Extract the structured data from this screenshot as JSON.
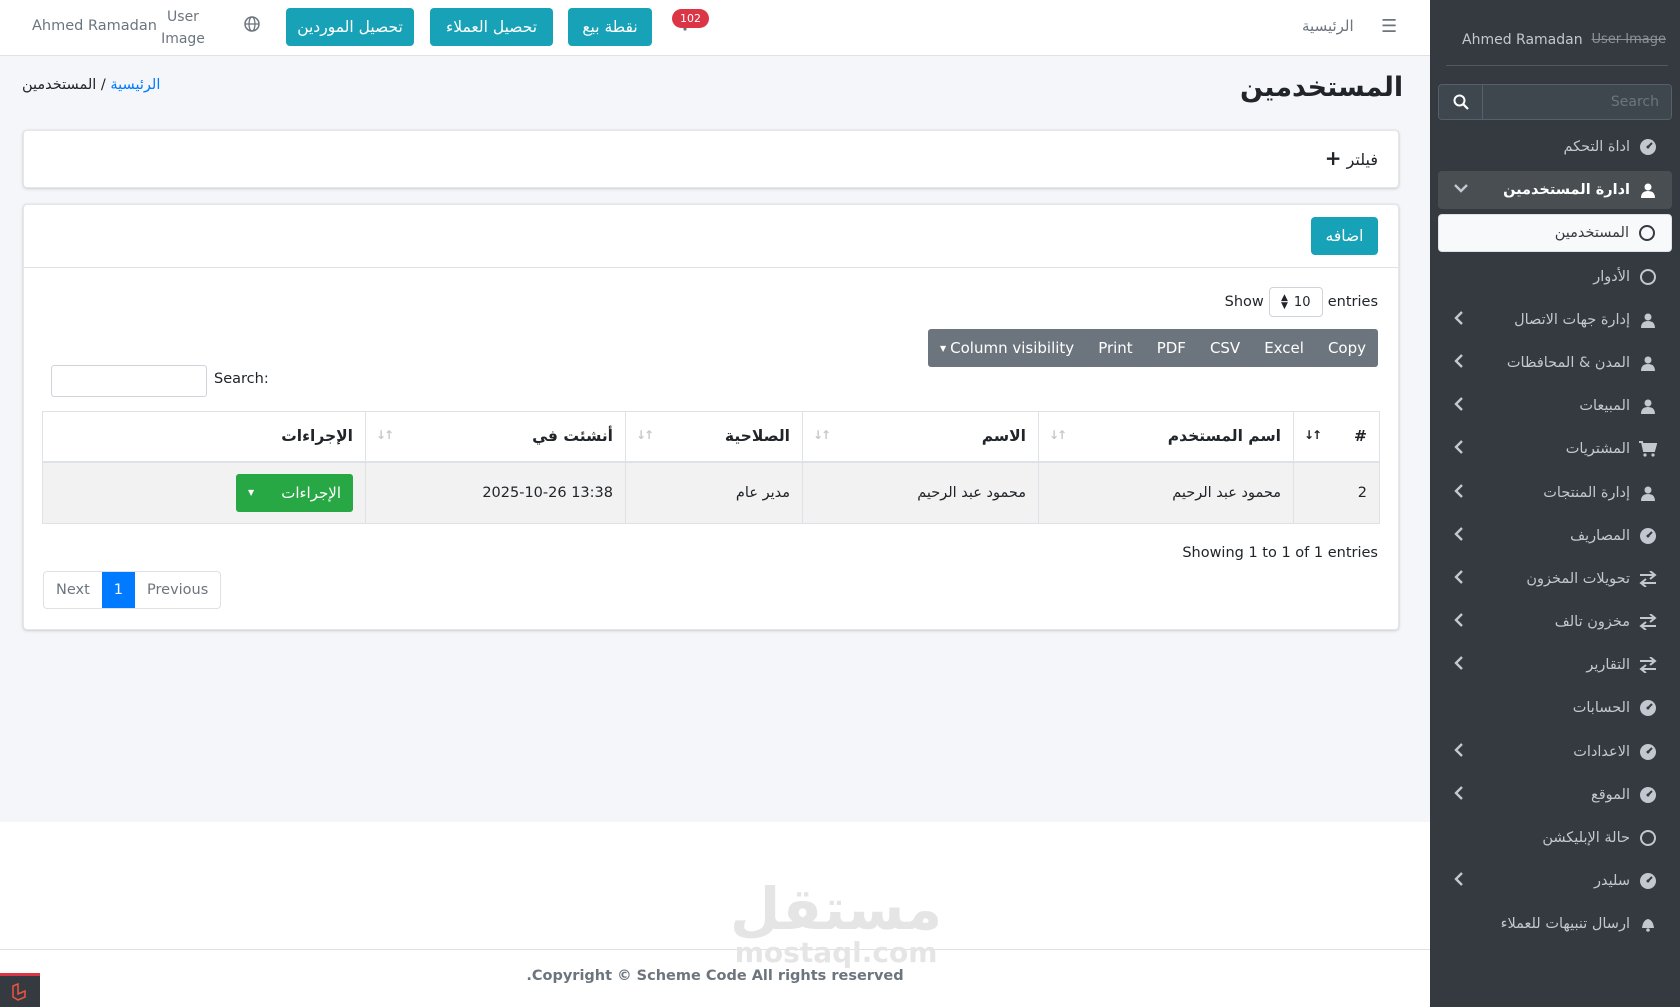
{
  "sidebar": {
    "user_name": "Ahmed Ramadan",
    "user_image_alt": "User Image",
    "search_placeholder": "Search",
    "items": [
      {
        "label": "اداة التحكم",
        "icon": "dashboard-icon",
        "chevron": false
      },
      {
        "label": "ادارة المستخدمين",
        "icon": "user-icon",
        "chevron": true,
        "state": "active"
      },
      {
        "label": "المستخدمين",
        "icon": "circle-icon",
        "chevron": false,
        "state": "current"
      },
      {
        "label": "الأدوار",
        "icon": "circle-icon",
        "chevron": false
      },
      {
        "label": "إدارة جهات الاتصال",
        "icon": "user-icon",
        "chevron": true
      },
      {
        "label": "المدن & المحافظات",
        "icon": "user-icon",
        "chevron": true
      },
      {
        "label": "المبيعات",
        "icon": "user-icon",
        "chevron": true
      },
      {
        "label": "المشتريات",
        "icon": "cart-icon",
        "chevron": true
      },
      {
        "label": "إدارة المنتجات",
        "icon": "user-icon",
        "chevron": true
      },
      {
        "label": "المصاريف",
        "icon": "dashboard-icon",
        "chevron": true
      },
      {
        "label": "تحويلات المخزون",
        "icon": "exchange-icon",
        "chevron": true
      },
      {
        "label": "مخزون تالف",
        "icon": "exchange-icon",
        "chevron": true
      },
      {
        "label": "التقارير",
        "icon": "exchange-icon",
        "chevron": true
      },
      {
        "label": "الحسابات",
        "icon": "dashboard-icon",
        "chevron": false
      },
      {
        "label": "الاعدادات",
        "icon": "dashboard-icon",
        "chevron": true
      },
      {
        "label": "الموقع",
        "icon": "dashboard-icon",
        "chevron": true
      },
      {
        "label": "حالة الإبليكشن",
        "icon": "circle-icon",
        "chevron": false
      },
      {
        "label": "سليدر",
        "icon": "dashboard-icon",
        "chevron": true
      },
      {
        "label": "ارسال تنبيهات للعملاء",
        "icon": "bell-icon",
        "chevron": false
      }
    ]
  },
  "topbar": {
    "home_label": "الرئيسية",
    "btn_pos": "نقطة بيع",
    "btn_customers": "تحصيل العملاء",
    "btn_suppliers": "تحصيل الموردين",
    "notification_count": "102",
    "user_image_alt": "User Image",
    "user_name": "Ahmed Ramadan"
  },
  "page": {
    "title": "المستخدمين",
    "breadcrumb_home": "الرئيسية",
    "breadcrumb_sep": " / ",
    "breadcrumb_current": "المستخدمين",
    "filter_label": "فيلتر",
    "add_button": "اضافه",
    "show_label": "Show",
    "entries_label": "entries",
    "page_size": "10",
    "export_buttons": [
      "Copy",
      "Excel",
      "CSV",
      "PDF",
      "Print",
      "Column visibility"
    ],
    "search_label": "Search:",
    "columns": [
      "#",
      "اسم المستخدم",
      "الاسم",
      "الصلاحية",
      "أنشئت في",
      "الإجراءات"
    ],
    "rows": [
      {
        "id": "2",
        "username": "محمود عبد الرحيم",
        "name": "محمود عبد الرحيم",
        "role": "مدير عام",
        "created_at": "2025-10-26 13:38",
        "action": "الإجراءات"
      }
    ],
    "info": "Showing 1 to 1 of 1 entries",
    "pager": {
      "previous": "Previous",
      "current": "1",
      "next": "Next"
    }
  },
  "footer": {
    "copyright": "Copyright © Scheme Code All rights reserved."
  },
  "watermark": {
    "arabic": "مستقل",
    "latin": "mostaql.com"
  },
  "colors": {
    "sidebar": "#343a40",
    "info": "#17a2b8",
    "success": "#28a745",
    "primary": "#007bff",
    "danger": "#dc3545",
    "secondary": "#6c757d"
  }
}
